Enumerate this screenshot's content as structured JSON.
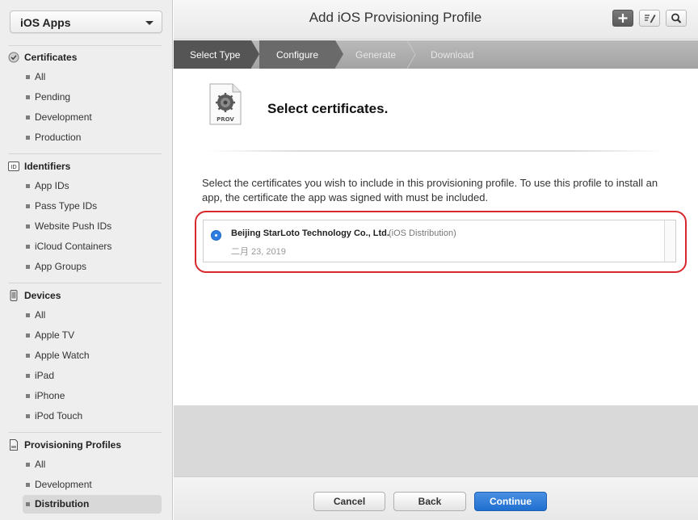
{
  "sidebar": {
    "app_select": "iOS Apps",
    "sections": [
      {
        "title": "Certificates",
        "icon": "certificate-icon",
        "items": [
          "All",
          "Pending",
          "Development",
          "Production"
        ]
      },
      {
        "title": "Identifiers",
        "icon": "id-badge-icon",
        "icon_text": "ID",
        "items": [
          "App IDs",
          "Pass Type IDs",
          "Website Push IDs",
          "iCloud Containers",
          "App Groups"
        ]
      },
      {
        "title": "Devices",
        "icon": "device-icon",
        "items": [
          "All",
          "Apple TV",
          "Apple Watch",
          "iPad",
          "iPhone",
          "iPod Touch"
        ]
      },
      {
        "title": "Provisioning Profiles",
        "icon": "document-icon",
        "items": [
          "All",
          "Development",
          "Distribution"
        ]
      }
    ],
    "active_item": "Distribution"
  },
  "header": {
    "title": "Add iOS Provisioning Profile",
    "buttons": [
      "add-icon",
      "edit-icon",
      "search-icon"
    ]
  },
  "steps": [
    "Select Type",
    "Configure",
    "Generate",
    "Download"
  ],
  "main": {
    "icon_label": "PROV",
    "heading": "Select certificates.",
    "description": "Select the certificates you wish to include in this provisioning profile. To use this profile to install an app, the certificate the app was signed with must be included.",
    "certificate": {
      "name": "Beijing StarLoto Technology Co., Ltd.",
      "type": "(iOS Distribution)",
      "date": "二月 23, 2019"
    }
  },
  "footer": {
    "cancel": "Cancel",
    "back": "Back",
    "continue": "Continue"
  },
  "colors": {
    "accent": "#1f6fd0",
    "highlight": "#d8272d"
  }
}
